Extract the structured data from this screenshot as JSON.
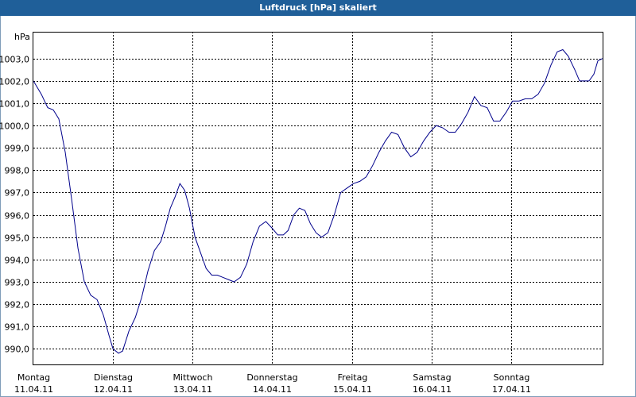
{
  "window": {
    "title": "Luftdruck [hPa] skaliert"
  },
  "colors": {
    "titlebar": "#1f5f99",
    "line": "#00008b",
    "grid": "#000000"
  },
  "chart_data": {
    "type": "line",
    "title": "Luftdruck [hPa] skaliert",
    "ylabel": "hPa",
    "xlabel": "",
    "grid": true,
    "ylim": [
      989.3,
      1004.2
    ],
    "xlim": [
      0,
      7.15
    ],
    "y_ticks": [
      "990,0",
      "991,0",
      "992,0",
      "993,0",
      "994,0",
      "995,0",
      "996,0",
      "997,0",
      "998,0",
      "999,0",
      "1000,0",
      "1001,0",
      "1002,0",
      "1003,0"
    ],
    "y_tick_values": [
      990,
      991,
      992,
      993,
      994,
      995,
      996,
      997,
      998,
      999,
      1000,
      1001,
      1002,
      1003
    ],
    "x_ticks": [
      {
        "day": "Montag",
        "date": "11.04.11"
      },
      {
        "day": "Dienstag",
        "date": "12.04.11"
      },
      {
        "day": "Mittwoch",
        "date": "13.04.11"
      },
      {
        "day": "Donnerstag",
        "date": "14.04.11"
      },
      {
        "day": "Freitag",
        "date": "15.04.11"
      },
      {
        "day": "Samstag",
        "date": "16.04.11"
      },
      {
        "day": "Sonntag",
        "date": "17.04.11"
      }
    ],
    "series": [
      {
        "values": [
          [
            0.0,
            1002.0
          ],
          [
            0.1,
            1001.4
          ],
          [
            0.18,
            1000.8
          ],
          [
            0.25,
            1000.7
          ],
          [
            0.32,
            1000.3
          ],
          [
            0.4,
            998.8
          ],
          [
            0.48,
            996.7
          ],
          [
            0.56,
            994.5
          ],
          [
            0.64,
            993.0
          ],
          [
            0.72,
            992.4
          ],
          [
            0.8,
            992.2
          ],
          [
            0.88,
            991.5
          ],
          [
            0.95,
            990.6
          ],
          [
            1.0,
            990.0
          ],
          [
            1.07,
            989.8
          ],
          [
            1.12,
            989.9
          ],
          [
            1.2,
            990.8
          ],
          [
            1.28,
            991.4
          ],
          [
            1.36,
            992.3
          ],
          [
            1.44,
            993.5
          ],
          [
            1.52,
            994.4
          ],
          [
            1.6,
            994.8
          ],
          [
            1.66,
            995.5
          ],
          [
            1.72,
            996.3
          ],
          [
            1.78,
            996.8
          ],
          [
            1.84,
            997.4
          ],
          [
            1.9,
            997.1
          ],
          [
            1.96,
            996.3
          ],
          [
            2.03,
            995.0
          ],
          [
            2.1,
            994.3
          ],
          [
            2.17,
            993.6
          ],
          [
            2.24,
            993.3
          ],
          [
            2.31,
            993.3
          ],
          [
            2.38,
            993.2
          ],
          [
            2.45,
            993.1
          ],
          [
            2.52,
            993.0
          ],
          [
            2.6,
            993.2
          ],
          [
            2.68,
            993.8
          ],
          [
            2.76,
            994.8
          ],
          [
            2.84,
            995.5
          ],
          [
            2.92,
            995.7
          ],
          [
            3.0,
            995.4
          ],
          [
            3.07,
            995.1
          ],
          [
            3.14,
            995.1
          ],
          [
            3.2,
            995.3
          ],
          [
            3.27,
            996.0
          ],
          [
            3.34,
            996.3
          ],
          [
            3.41,
            996.2
          ],
          [
            3.48,
            995.6
          ],
          [
            3.55,
            995.2
          ],
          [
            3.62,
            995.0
          ],
          [
            3.7,
            995.2
          ],
          [
            3.78,
            996.0
          ],
          [
            3.86,
            997.0
          ],
          [
            3.94,
            997.2
          ],
          [
            4.02,
            997.4
          ],
          [
            4.1,
            997.5
          ],
          [
            4.18,
            997.7
          ],
          [
            4.26,
            998.2
          ],
          [
            4.34,
            998.8
          ],
          [
            4.42,
            999.3
          ],
          [
            4.5,
            999.7
          ],
          [
            4.58,
            999.6
          ],
          [
            4.66,
            999.0
          ],
          [
            4.74,
            998.6
          ],
          [
            4.82,
            998.8
          ],
          [
            4.9,
            999.3
          ],
          [
            4.98,
            999.7
          ],
          [
            5.06,
            1000.0
          ],
          [
            5.14,
            999.9
          ],
          [
            5.22,
            999.7
          ],
          [
            5.3,
            999.7
          ],
          [
            5.38,
            1000.1
          ],
          [
            5.46,
            1000.6
          ],
          [
            5.54,
            1001.3
          ],
          [
            5.62,
            1000.9
          ],
          [
            5.7,
            1000.8
          ],
          [
            5.78,
            1000.2
          ],
          [
            5.86,
            1000.2
          ],
          [
            5.94,
            1000.6
          ],
          [
            6.02,
            1001.1
          ],
          [
            6.1,
            1001.1
          ],
          [
            6.18,
            1001.2
          ],
          [
            6.26,
            1001.2
          ],
          [
            6.34,
            1001.4
          ],
          [
            6.42,
            1001.9
          ],
          [
            6.5,
            1002.7
          ],
          [
            6.58,
            1003.3
          ],
          [
            6.65,
            1003.4
          ],
          [
            6.72,
            1003.1
          ],
          [
            6.8,
            1002.5
          ],
          [
            6.86,
            1002.0
          ],
          [
            6.92,
            1002.0
          ],
          [
            6.98,
            1002.0
          ],
          [
            7.04,
            1002.3
          ],
          [
            7.09,
            1002.9
          ],
          [
            7.15,
            1003.0
          ]
        ]
      }
    ]
  }
}
